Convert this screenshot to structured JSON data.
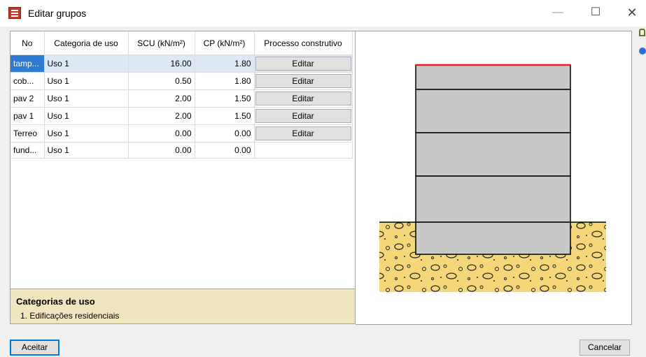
{
  "window": {
    "title": "Editar grupos",
    "minimize_glyph": "—",
    "maximize_glyph": "☐",
    "close_glyph": "✕"
  },
  "table": {
    "columns": [
      "No",
      "Categoria de uso",
      "SCU (kN/m²)",
      "CP (kN/m²)",
      "Processo construtivo"
    ],
    "rows": [
      {
        "no": "tamp...",
        "categoria": "Uso 1",
        "scu": "16.00",
        "cp": "1.80",
        "processo": "Editar",
        "selected": true
      },
      {
        "no": "cob...",
        "categoria": "Uso 1",
        "scu": "0.50",
        "cp": "1.80",
        "processo": "Editar"
      },
      {
        "no": "pav 2",
        "categoria": "Uso 1",
        "scu": "2.00",
        "cp": "1.50",
        "processo": "Editar"
      },
      {
        "no": "pav 1",
        "categoria": "Uso 1",
        "scu": "2.00",
        "cp": "1.50",
        "processo": "Editar"
      },
      {
        "no": "Terreo",
        "categoria": "Uso 1",
        "scu": "0.00",
        "cp": "0.00",
        "processo": "Editar"
      },
      {
        "no": "fund...",
        "categoria": "Uso 1",
        "scu": "0.00",
        "cp": "0.00",
        "processo": ""
      }
    ]
  },
  "categories_panel": {
    "title": "Categorias de uso",
    "items": [
      "1. Edificações residenciais"
    ]
  },
  "buttons": {
    "accept": "Aceitar",
    "cancel": "Cancelar"
  },
  "colors": {
    "selection": "#2e7bd1",
    "top_line": "#e02020",
    "soil": "#f5d77a",
    "storey": "#c8c8c8",
    "category_panel": "#efe6c0"
  },
  "icons": {
    "app": "edit-groups-icon",
    "side_top": "building-icon",
    "side_bottom": "help-globe-icon"
  }
}
